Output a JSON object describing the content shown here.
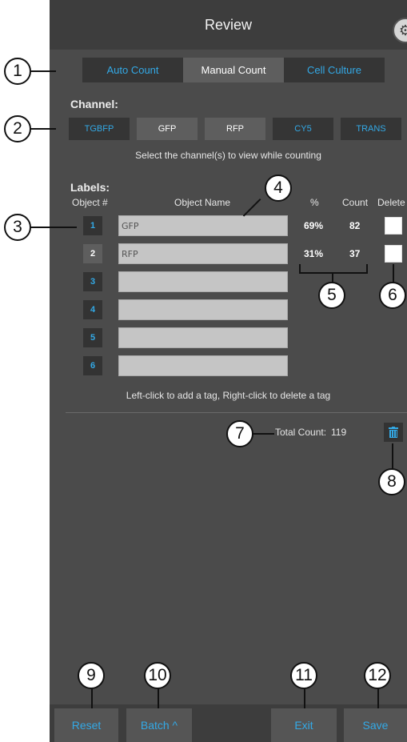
{
  "header": {
    "title": "Review"
  },
  "mode_tabs": [
    {
      "label": "Auto Count",
      "active": false
    },
    {
      "label": "Manual Count",
      "active": true
    },
    {
      "label": "Cell Culture",
      "active": false
    }
  ],
  "channel": {
    "title": "Channel:",
    "items": [
      {
        "label": "TGBFP",
        "selected": false
      },
      {
        "label": "GFP",
        "selected": true
      },
      {
        "label": "RFP",
        "selected": true
      },
      {
        "label": "CY5",
        "selected": false
      },
      {
        "label": "TRANS",
        "selected": false
      }
    ],
    "hint": "Select the channel(s) to view while counting"
  },
  "labels": {
    "title": "Labels:",
    "headers": {
      "object_num": "Object #",
      "object_name": "Object Name",
      "percent": "%",
      "count": "Count",
      "delete": "Delete"
    },
    "rows": [
      {
        "num": "1",
        "name": "GFP",
        "percent": "69%",
        "count": "82",
        "has_delete": true
      },
      {
        "num": "2",
        "name": "RFP",
        "percent": "31%",
        "count": "37",
        "has_delete": true
      },
      {
        "num": "3",
        "name": "",
        "percent": "",
        "count": "",
        "has_delete": false
      },
      {
        "num": "4",
        "name": "",
        "percent": "",
        "count": "",
        "has_delete": false
      },
      {
        "num": "5",
        "name": "",
        "percent": "",
        "count": "",
        "has_delete": false
      },
      {
        "num": "6",
        "name": "",
        "percent": "",
        "count": "",
        "has_delete": false
      }
    ],
    "hint": "Left-click to add a tag, Right-click to delete a tag"
  },
  "total": {
    "label": "Total Count:",
    "value": "119"
  },
  "bottom": {
    "reset": "Reset",
    "batch": "Batch ^",
    "exit": "Exit",
    "save": "Save"
  },
  "callouts": [
    "1",
    "2",
    "3",
    "4",
    "5",
    "6",
    "7",
    "8",
    "9",
    "10",
    "11",
    "12"
  ],
  "colors": {
    "accent": "#33a9e6",
    "panel": "#4b4b4b",
    "header": "#3d3d3d"
  }
}
